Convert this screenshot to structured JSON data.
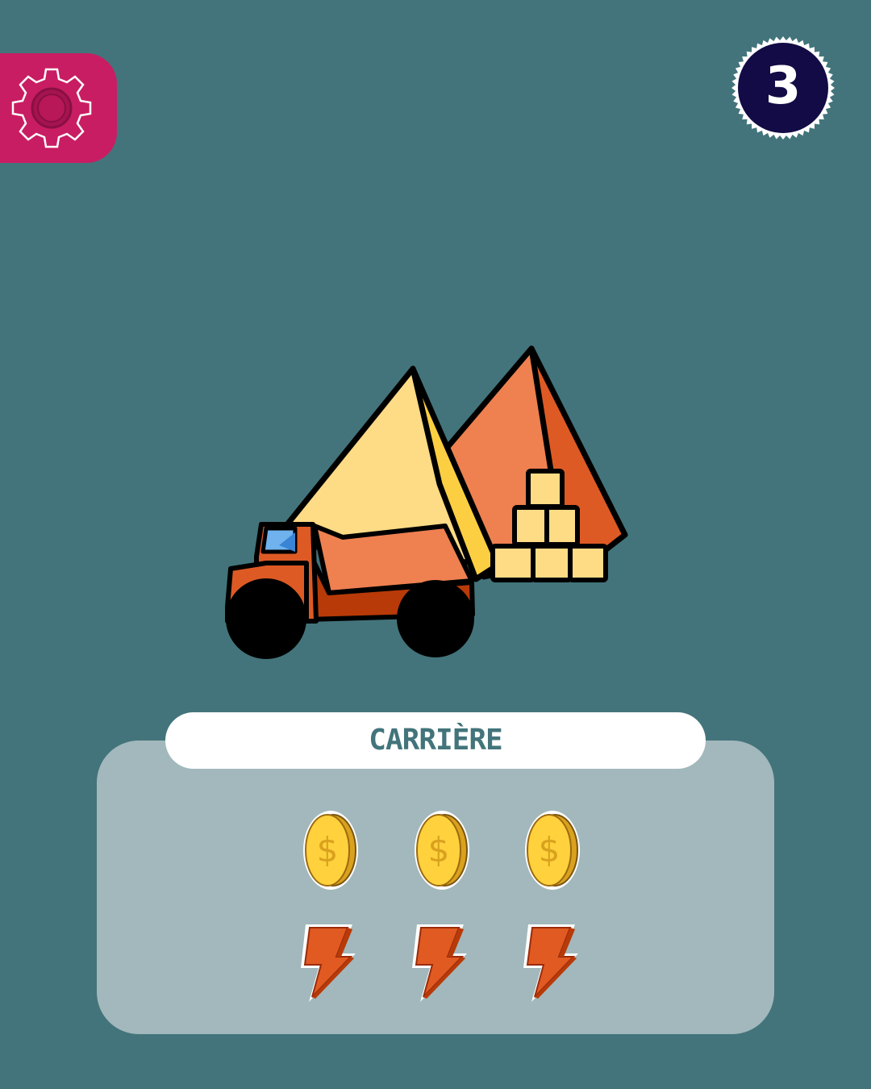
{
  "settings": {
    "icon": "gear-icon",
    "color": "#c81d62"
  },
  "badge": {
    "value": "3",
    "color": "#120b45"
  },
  "card": {
    "title": "CARRIÈRE",
    "coins": {
      "count": 3,
      "icon": "coin-icon",
      "symbol": "$"
    },
    "energy": {
      "count": 3,
      "icon": "lightning-bolt-icon"
    }
  },
  "colors": {
    "background": "#43747b",
    "panel": "#a2b8bc",
    "pill": "#ffffff",
    "title_text": "#43747b",
    "coin": "#ffd13d",
    "bolt": "#e05a22"
  },
  "illustration": {
    "subject": "quarry-scene",
    "icons": [
      "pyramid-icon",
      "dump-truck-icon",
      "stone-blocks-icon"
    ]
  }
}
